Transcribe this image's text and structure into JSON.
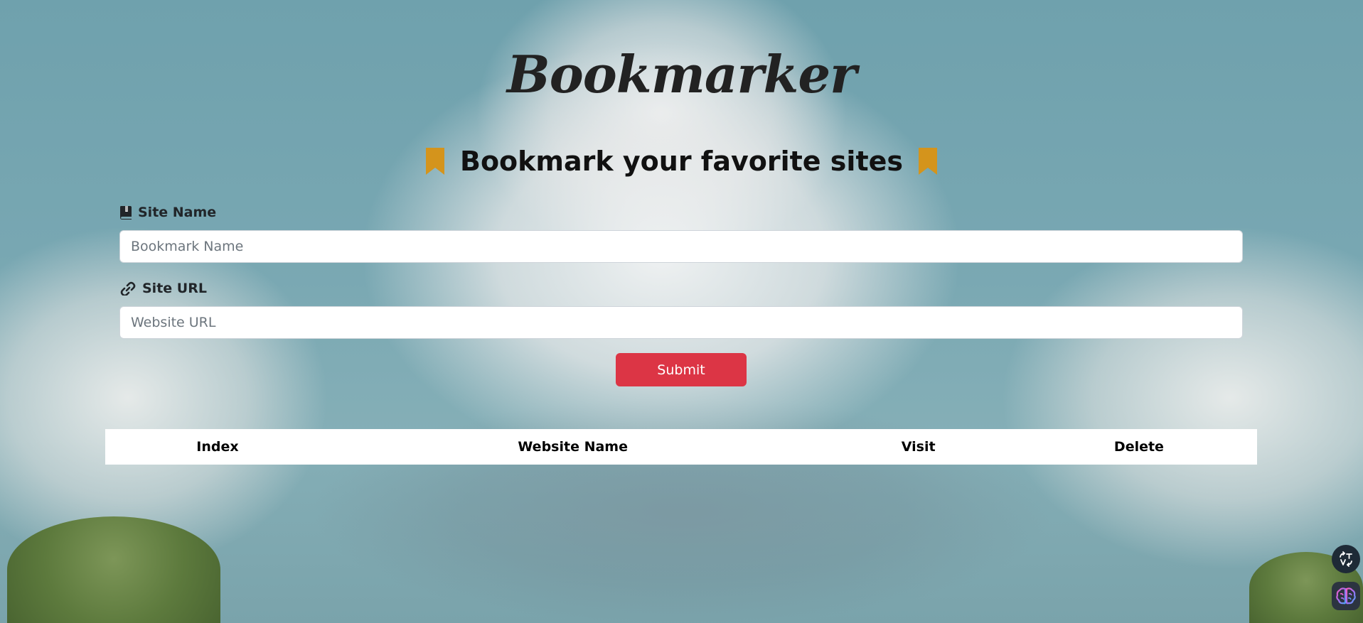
{
  "header": {
    "title": "Bookmarker",
    "subtitle": "Bookmark your favorite sites",
    "badge_icon": "bookmark-icon",
    "accent_color": "#d4941c"
  },
  "form": {
    "site_name": {
      "label": "Site Name",
      "icon": "book-icon",
      "placeholder": "Bookmark Name",
      "value": ""
    },
    "site_url": {
      "label": "Site URL",
      "icon": "link-icon",
      "placeholder": "Website URL",
      "value": ""
    },
    "submit_label": "Submit",
    "submit_color": "#dc3545"
  },
  "table": {
    "columns": [
      "Index",
      "Website Name",
      "Visit",
      "Delete"
    ],
    "rows": []
  },
  "floating_actions": [
    {
      "icon": "translate-icon"
    },
    {
      "icon": "brain-icon"
    }
  ]
}
